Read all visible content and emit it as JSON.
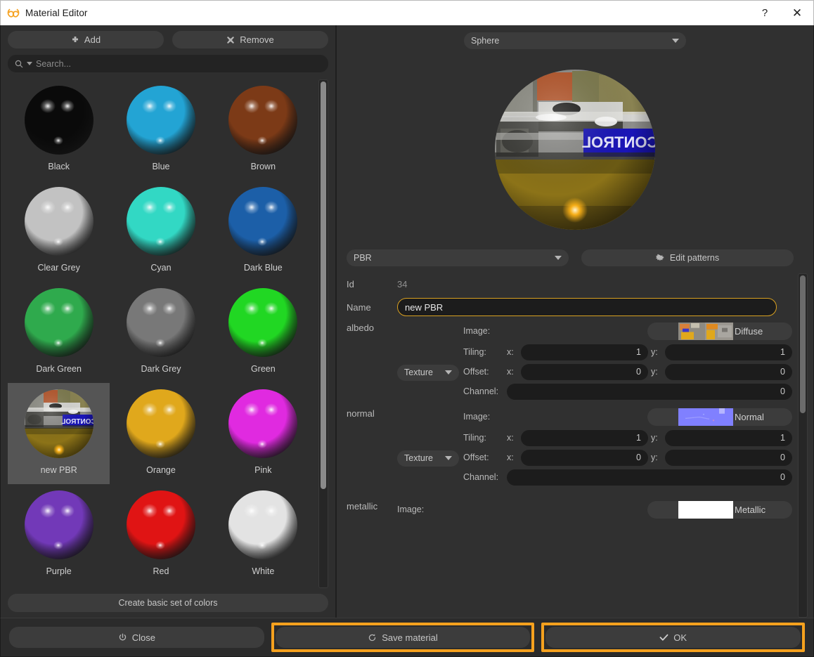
{
  "window": {
    "title": "Material Editor",
    "app_icon": "infinity-knot-icon",
    "accent_color": "#f5a11e",
    "help_label": "?",
    "close_label": "✕"
  },
  "left_panel": {
    "add_button": {
      "label": "Add",
      "icon": "plus-icon"
    },
    "remove_button": {
      "label": "Remove",
      "icon": "cross-icon"
    },
    "search": {
      "placeholder": "Search...",
      "value": "",
      "icon": "search-icon"
    },
    "create_set_button": {
      "label": "Create basic set of colors"
    },
    "materials": [
      {
        "name": "Black",
        "color": "#0a0a0a",
        "selected": false,
        "kind": "solid"
      },
      {
        "name": "Blue",
        "color": "#23a4d4",
        "selected": false,
        "kind": "solid"
      },
      {
        "name": "Brown",
        "color": "#7c3a17",
        "selected": false,
        "kind": "solid"
      },
      {
        "name": "Clear Grey",
        "color": "#c2c2c2",
        "selected": false,
        "kind": "solid"
      },
      {
        "name": "Cyan",
        "color": "#32d8c4",
        "selected": false,
        "kind": "solid"
      },
      {
        "name": "Dark Blue",
        "color": "#1c5fa8",
        "selected": false,
        "kind": "solid"
      },
      {
        "name": "Dark Green",
        "color": "#2faa4d",
        "selected": false,
        "kind": "solid"
      },
      {
        "name": "Dark Grey",
        "color": "#787878",
        "selected": false,
        "kind": "solid"
      },
      {
        "name": "Green",
        "color": "#21d723",
        "selected": false,
        "kind": "solid"
      },
      {
        "name": "new PBR",
        "color": "#8a7430",
        "selected": true,
        "kind": "pbr"
      },
      {
        "name": "Orange",
        "color": "#e0a81c",
        "selected": false,
        "kind": "solid"
      },
      {
        "name": "Pink",
        "color": "#e02ae0",
        "selected": false,
        "kind": "solid"
      },
      {
        "name": "Purple",
        "color": "#7239b8",
        "selected": false,
        "kind": "solid"
      },
      {
        "name": "Red",
        "color": "#e01414",
        "selected": false,
        "kind": "solid"
      },
      {
        "name": "White",
        "color": "#e3e3e3",
        "selected": false,
        "kind": "solid"
      }
    ]
  },
  "right_panel": {
    "shape_selector": {
      "value": "Sphere",
      "icon": "chevron-down-icon"
    },
    "type_selector": {
      "value": "PBR",
      "icon": "chevron-down-icon"
    },
    "edit_patterns_button": {
      "label": "Edit patterns",
      "icon": "gear-icon"
    },
    "fields": {
      "id_label": "Id",
      "id_value": "34",
      "name_label": "Name",
      "name_value": "new PBR"
    },
    "maps": [
      {
        "name": "albedo",
        "type": "Texture",
        "image_label": "Image:",
        "image_button_label": "Diffuse",
        "image_thumb": "diffuse-texture-thumbnail",
        "tiling_label": "Tiling:",
        "tiling_x": "1",
        "tiling_y": "1",
        "offset_label": "Offset:",
        "offset_x": "0",
        "offset_y": "0",
        "channel_label": "Channel:",
        "channel": "0",
        "x_label": "x:",
        "y_label": "y:"
      },
      {
        "name": "normal",
        "type": "Texture",
        "image_label": "Image:",
        "image_button_label": "Normal",
        "image_thumb": "normal-map-thumbnail",
        "tiling_label": "Tiling:",
        "tiling_x": "1",
        "tiling_y": "1",
        "offset_label": "Offset:",
        "offset_x": "0",
        "offset_y": "0",
        "channel_label": "Channel:",
        "channel": "0",
        "x_label": "x:",
        "y_label": "y:"
      },
      {
        "name": "metallic",
        "type": "",
        "image_label": "Image:",
        "image_button_label": "Metallic",
        "image_thumb": "metallic-map-thumbnail",
        "partial": true
      }
    ]
  },
  "footer": {
    "close_button": {
      "label": "Close",
      "icon": "power-icon",
      "highlighted": false
    },
    "save_button": {
      "label": "Save material",
      "icon": "refresh-icon",
      "highlighted": true
    },
    "ok_button": {
      "label": "OK",
      "icon": "check-icon",
      "highlighted": true
    }
  }
}
